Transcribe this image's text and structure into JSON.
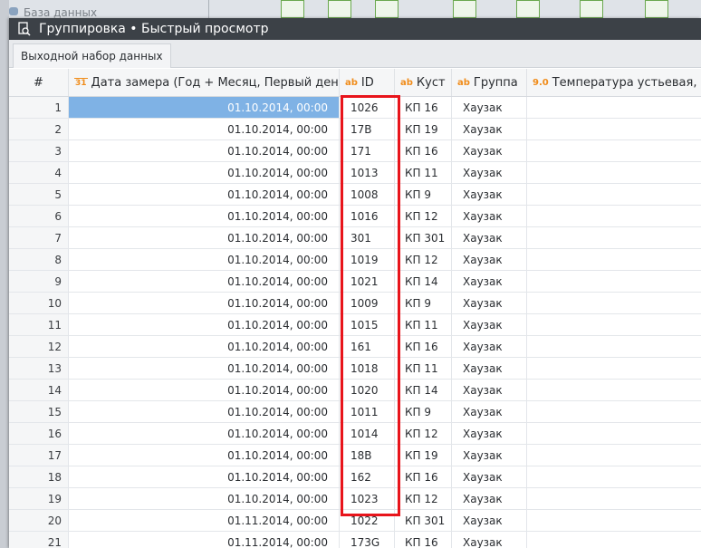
{
  "background": {
    "db_label": "База данных"
  },
  "window": {
    "title": "Группировка • Быстрый просмотр",
    "tab_label": "Выходной набор данных"
  },
  "columns": [
    {
      "label": "#",
      "type_icon": ""
    },
    {
      "label": "Дата замера (Год + Месяц, Первый день)",
      "type_icon": "31"
    },
    {
      "label": "ID",
      "type_icon": "ab"
    },
    {
      "label": "Куст",
      "type_icon": "ab"
    },
    {
      "label": "Группа",
      "type_icon": "ab"
    },
    {
      "label": "Температура устьевая, С|С",
      "type_icon": "9.0"
    }
  ],
  "rows": [
    {
      "n": "1",
      "date": "01.10.2014, 00:00",
      "id": "1026",
      "bush": "КП 16",
      "group": "Хаузак"
    },
    {
      "n": "2",
      "date": "01.10.2014, 00:00",
      "id": "17B",
      "bush": "КП 19",
      "group": "Хаузак"
    },
    {
      "n": "3",
      "date": "01.10.2014, 00:00",
      "id": "171",
      "bush": "КП 16",
      "group": "Хаузак"
    },
    {
      "n": "4",
      "date": "01.10.2014, 00:00",
      "id": "1013",
      "bush": "КП 11",
      "group": "Хаузак"
    },
    {
      "n": "5",
      "date": "01.10.2014, 00:00",
      "id": "1008",
      "bush": "КП 9",
      "group": "Хаузак"
    },
    {
      "n": "6",
      "date": "01.10.2014, 00:00",
      "id": "1016",
      "bush": "КП 12",
      "group": "Хаузак"
    },
    {
      "n": "7",
      "date": "01.10.2014, 00:00",
      "id": "301",
      "bush": "КП 301",
      "group": "Хаузак"
    },
    {
      "n": "8",
      "date": "01.10.2014, 00:00",
      "id": "1019",
      "bush": "КП 12",
      "group": "Хаузак"
    },
    {
      "n": "9",
      "date": "01.10.2014, 00:00",
      "id": "1021",
      "bush": "КП 14",
      "group": "Хаузак"
    },
    {
      "n": "10",
      "date": "01.10.2014, 00:00",
      "id": "1009",
      "bush": "КП 9",
      "group": "Хаузак"
    },
    {
      "n": "11",
      "date": "01.10.2014, 00:00",
      "id": "1015",
      "bush": "КП 11",
      "group": "Хаузак"
    },
    {
      "n": "12",
      "date": "01.10.2014, 00:00",
      "id": "161",
      "bush": "КП 16",
      "group": "Хаузак"
    },
    {
      "n": "13",
      "date": "01.10.2014, 00:00",
      "id": "1018",
      "bush": "КП 11",
      "group": "Хаузак"
    },
    {
      "n": "14",
      "date": "01.10.2014, 00:00",
      "id": "1020",
      "bush": "КП 14",
      "group": "Хаузак"
    },
    {
      "n": "15",
      "date": "01.10.2014, 00:00",
      "id": "1011",
      "bush": "КП 9",
      "group": "Хаузак"
    },
    {
      "n": "16",
      "date": "01.10.2014, 00:00",
      "id": "1014",
      "bush": "КП 12",
      "group": "Хаузак"
    },
    {
      "n": "17",
      "date": "01.10.2014, 00:00",
      "id": "18B",
      "bush": "КП 19",
      "group": "Хаузак"
    },
    {
      "n": "18",
      "date": "01.10.2014, 00:00",
      "id": "162",
      "bush": "КП 16",
      "group": "Хаузак"
    },
    {
      "n": "19",
      "date": "01.10.2014, 00:00",
      "id": "1023",
      "bush": "КП 12",
      "group": "Хаузак"
    },
    {
      "n": "20",
      "date": "01.11.2014, 00:00",
      "id": "1022",
      "bush": "КП 301",
      "group": "Хаузак"
    },
    {
      "n": "21",
      "date": "01.11.2014, 00:00",
      "id": "173G",
      "bush": "КП 16",
      "group": "Хаузак"
    }
  ],
  "selected_row": "1",
  "colors": {
    "titlebar": "#3c4147",
    "selection": "#7fb2e5",
    "highlight": "#e8141b",
    "type_icon": "#f08c1a"
  }
}
